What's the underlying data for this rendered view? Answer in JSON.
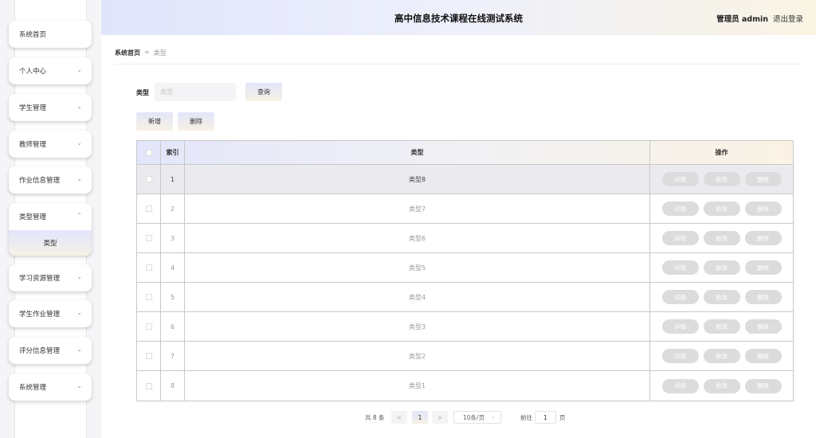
{
  "header": {
    "title": "高中信息技术课程在线测试系统",
    "user": "管理员 admin",
    "logout": "退出登录"
  },
  "sidebar": {
    "items": [
      {
        "label": "系统首页"
      },
      {
        "label": "个人中心"
      },
      {
        "label": "学生管理"
      },
      {
        "label": "教师管理"
      },
      {
        "label": "作业信息管理"
      },
      {
        "label": "类型管理",
        "expanded": true,
        "children": [
          {
            "label": "类型"
          }
        ]
      },
      {
        "label": "学习资源管理"
      },
      {
        "label": "学生作业管理"
      },
      {
        "label": "评分信息管理"
      },
      {
        "label": "系统管理"
      }
    ]
  },
  "breadcrumb": {
    "home": "系统首页",
    "separator": "≡",
    "current": "类型"
  },
  "search": {
    "label": "类型",
    "placeholder": "类型",
    "query_button": "查询"
  },
  "toolbar": {
    "add_label": "新增",
    "delete_label": "删除"
  },
  "table": {
    "headers": {
      "index": "索引",
      "type": "类型",
      "ops": "操作"
    },
    "op_labels": {
      "detail": "详情",
      "edit": "修改",
      "delete": "删除"
    },
    "rows": [
      {
        "index": "1",
        "type": "类型8"
      },
      {
        "index": "2",
        "type": "类型7"
      },
      {
        "index": "3",
        "type": "类型6"
      },
      {
        "index": "4",
        "type": "类型5"
      },
      {
        "index": "5",
        "type": "类型4"
      },
      {
        "index": "6",
        "type": "类型3"
      },
      {
        "index": "7",
        "type": "类型2"
      },
      {
        "index": "8",
        "type": "类型1"
      }
    ]
  },
  "pagination": {
    "total": "共 8 条",
    "prev": "<",
    "current_page": "1",
    "next": ">",
    "page_size": "10条/页",
    "goto_label": "前往",
    "goto_value": "1",
    "page_suffix": "页"
  },
  "colors": {
    "accent_start": "#e1e5fb",
    "accent_end": "#faf4e4",
    "op_button": "#dcdcdc"
  }
}
